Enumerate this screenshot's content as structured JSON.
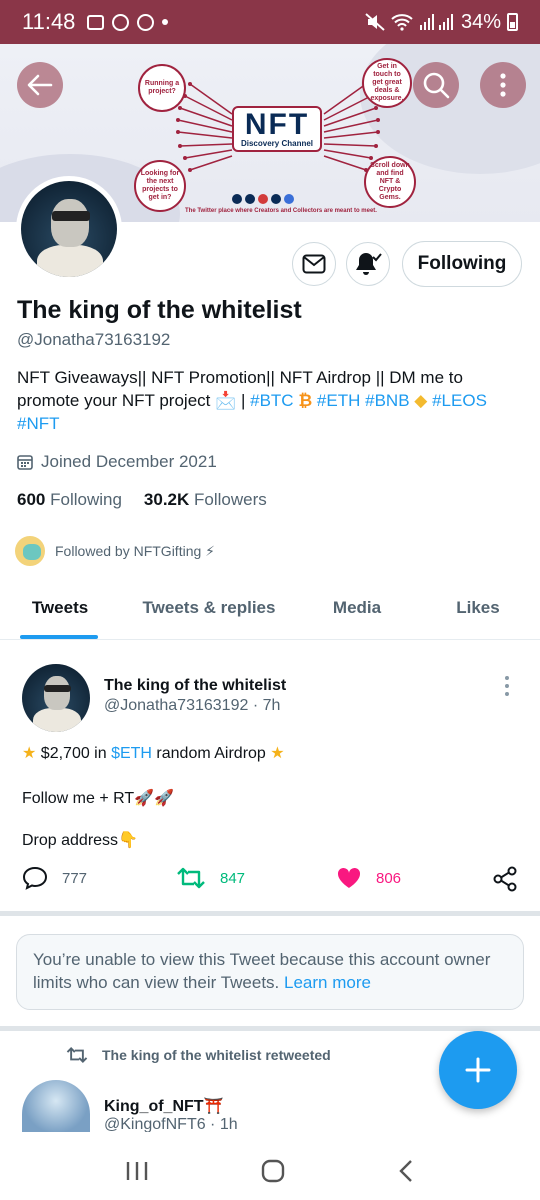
{
  "status_bar": {
    "time": "11:48",
    "battery": "34%"
  },
  "banner": {
    "logo_text": "NFT",
    "logo_subtitle": "Discovery Channel",
    "bubble_1": "Running a project?",
    "bubble_2": "Looking for the next projects to get in?",
    "bubble_3": "Get in touch to get great deals & exposure.",
    "bubble_4": "Scroll down and find NFT & Crypto Gems.",
    "tagline": "The Twitter place where Creators and Collectors are meant to meet."
  },
  "profile": {
    "name": "The king of the whitelist",
    "handle": "@Jonatha73163192",
    "bio_text": "NFT Giveaways|| NFT Promotion|| NFT Airdrop || DM me to promote your NFT project 📩  | ",
    "bio_tags": [
      "#BTC",
      "#ETH",
      "#BNB",
      "#LEOS",
      "#NFT"
    ],
    "joined": "Joined December 2021",
    "following_count": "600",
    "following_label": "Following",
    "followers_count": "30.2K",
    "followers_label": "Followers",
    "followed_by": "Followed by NFTGifting ⚡",
    "follow_button": "Following"
  },
  "tabs": [
    {
      "label": "Tweets",
      "active": true
    },
    {
      "label": "Tweets & replies",
      "active": false
    },
    {
      "label": "Media",
      "active": false
    },
    {
      "label": "Likes",
      "active": false
    }
  ],
  "tweet": {
    "name": "The king of the whitelist",
    "handle_time": "@Jonatha73163192 · 7h",
    "line1_pre": "$2,700 in ",
    "line1_tag": "$ETH",
    "line1_post": " random Airdrop",
    "line2": "Follow me + RT🚀🚀",
    "line3": "Drop address👇",
    "replies": "777",
    "retweets": "847",
    "likes": "806"
  },
  "notice": {
    "text": "You’re unable to view this Tweet because this account owner limits who can view their Tweets. ",
    "link": "Learn more"
  },
  "retweet": {
    "label": "The king of the whitelist retweeted",
    "name": "King_of_NFT⛩️",
    "handle_time": "@KingofNFT6 · 1h"
  },
  "colors": {
    "status_bar": "#8a3648",
    "accent": "#1d9bf0",
    "retweet_green": "#00ba7c",
    "like_pink": "#f91880"
  }
}
